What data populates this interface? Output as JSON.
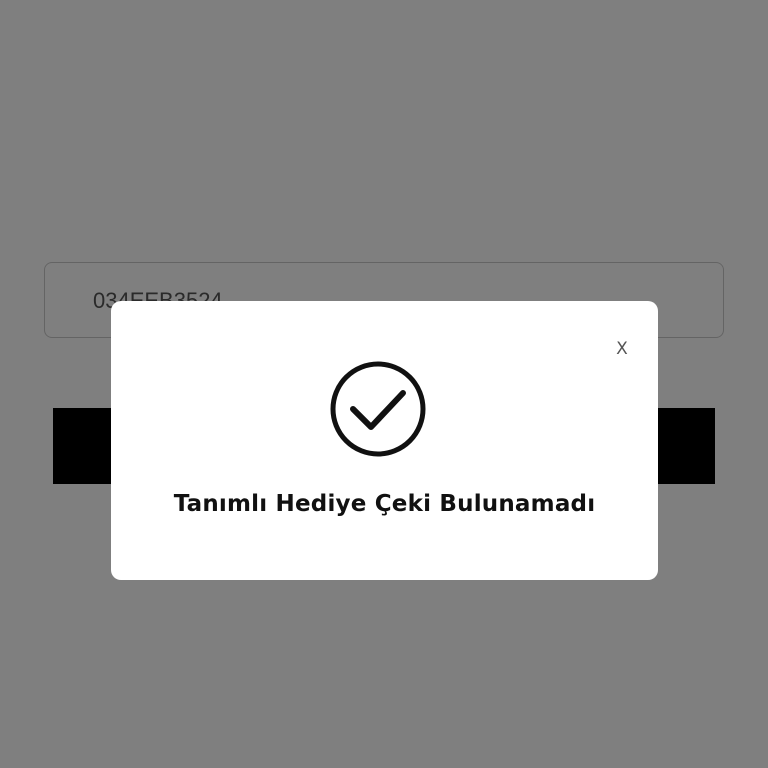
{
  "gift_code_form": {
    "code_value": "034EEB3524",
    "submit_label": ""
  },
  "dialog": {
    "close_label": "X",
    "icon": "checkmark-circle-icon",
    "message": "Tanımlı Hediye Çeki Bulunamadı"
  },
  "colors": {
    "overlay": "#808080",
    "dialog_background": "#ffffff",
    "button_background": "#000000",
    "text": "#111111"
  }
}
